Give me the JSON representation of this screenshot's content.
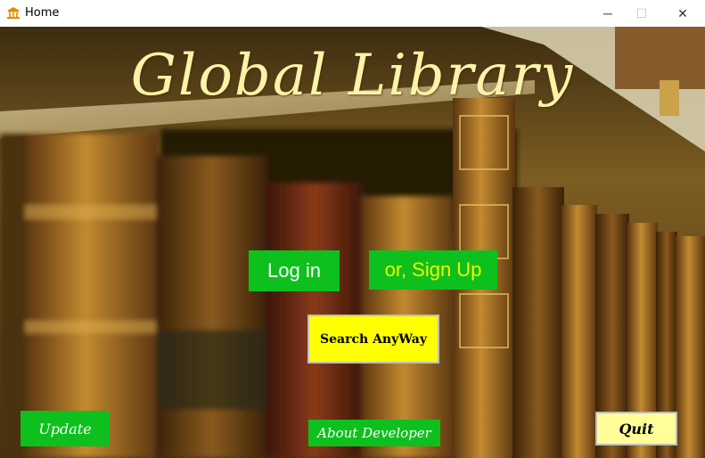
{
  "window": {
    "title": "Home",
    "icon": "library-icon",
    "controls": {
      "minimize": "─",
      "maximize": "☐",
      "close": "✕"
    }
  },
  "main": {
    "app_title": "Global Library",
    "background": "blurred-bookshelf-photo",
    "buttons": {
      "login": "Log in",
      "signup": "or, Sign Up",
      "search": "Search AnyWay",
      "update": "Update",
      "about": "About Developer",
      "quit": "Quit"
    }
  },
  "colors": {
    "green_button": "#0ec01e",
    "signup_text": "#f6f500",
    "search_button": "#ffff00",
    "quit_button": "#ffff99",
    "title_text": "#fbf3a8"
  }
}
